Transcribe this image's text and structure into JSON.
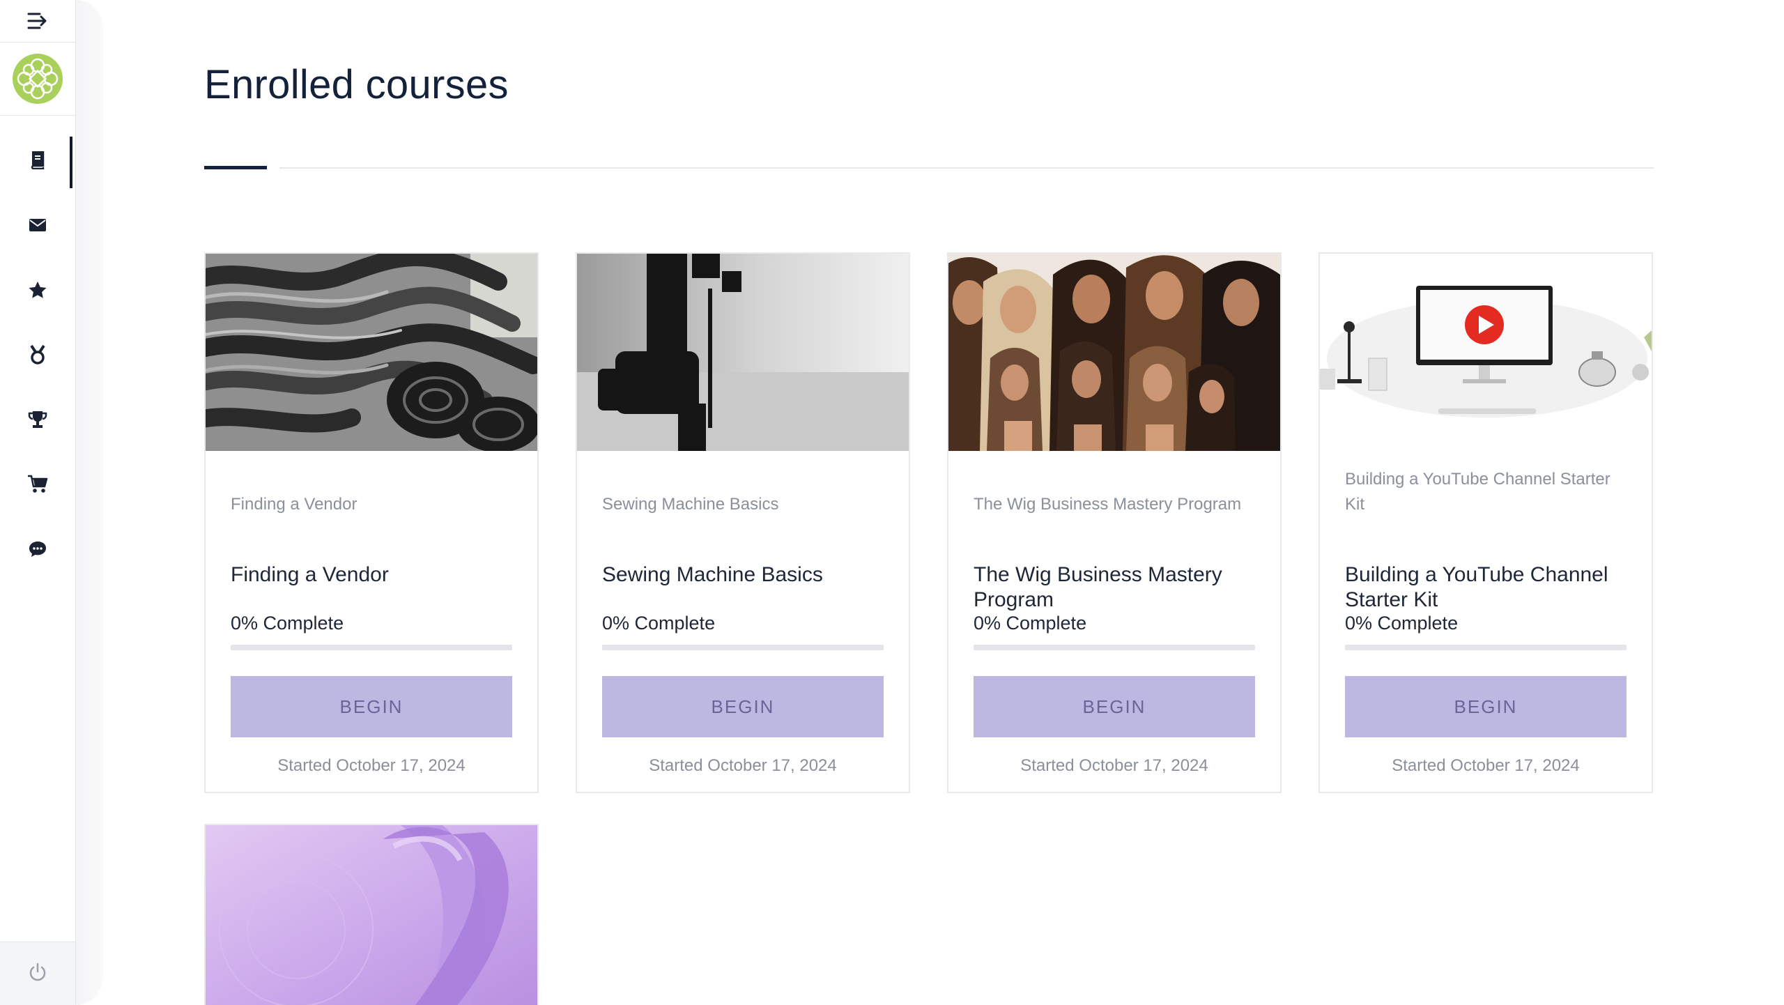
{
  "sidebar": {
    "items": [
      {
        "name": "book-icon",
        "active": true
      },
      {
        "name": "mail-icon",
        "active": false
      },
      {
        "name": "star-icon",
        "active": false
      },
      {
        "name": "medal-icon",
        "active": false
      },
      {
        "name": "trophy-icon",
        "active": false
      },
      {
        "name": "cart-icon",
        "active": false
      },
      {
        "name": "chat-icon",
        "active": false
      }
    ],
    "bottom_icon": "power-icon"
  },
  "page": {
    "title": "Enrolled courses"
  },
  "colors": {
    "accent": "#bcb8e1",
    "accent_text": "#6a6498",
    "title": "#13213a",
    "logo": "#a8d05a"
  },
  "courses": [
    {
      "subtitle": "Finding a Vendor",
      "title": "Finding a Vendor",
      "progress_label": "0% Complete",
      "progress": 0,
      "button": "BEGIN",
      "started": "Started October 17, 2024"
    },
    {
      "subtitle": "Sewing Machine Basics",
      "title": "Sewing Machine Basics",
      "progress_label": "0% Complete",
      "progress": 0,
      "button": "BEGIN",
      "started": "Started October 17, 2024"
    },
    {
      "subtitle": "The Wig Business Mastery Program",
      "title": "The Wig Business Mastery Program",
      "progress_label": "0% Complete",
      "progress": 0,
      "button": "BEGIN",
      "started": "Started October 17, 2024"
    },
    {
      "subtitle": "Building a YouTube Channel Starter Kit",
      "title": "Building a YouTube Channel Starter Kit",
      "progress_label": "0% Complete",
      "progress": 0,
      "button": "BEGIN",
      "started": "Started October 17, 2024"
    }
  ]
}
